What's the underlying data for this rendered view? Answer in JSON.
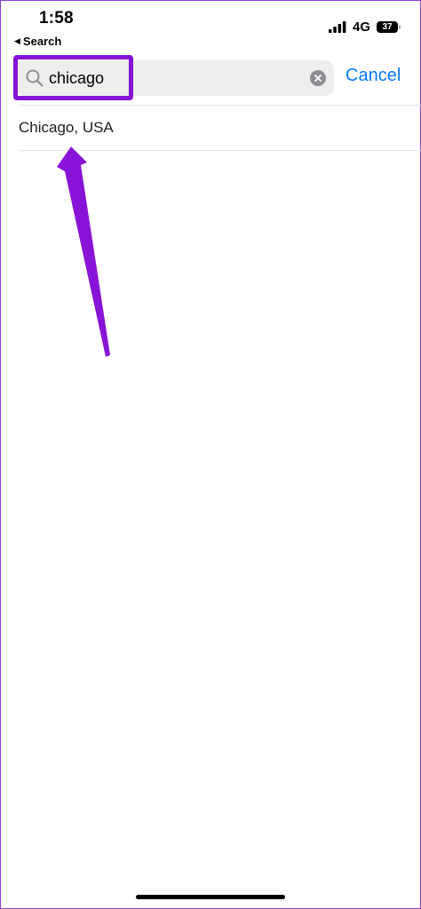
{
  "status_bar": {
    "time": "1:58",
    "back_label": "Search",
    "network": "4G",
    "battery_level": "37"
  },
  "search": {
    "value": "chicago",
    "cancel_label": "Cancel"
  },
  "results": [
    {
      "label": "Chicago, USA"
    }
  ],
  "colors": {
    "highlight": "#8714d6",
    "accent": "#0a7aff",
    "field_bg": "#eeeeef"
  },
  "icons": {
    "search": "search-icon",
    "clear": "clear-icon",
    "back": "back-triangle-icon",
    "signal": "signal-bars-icon",
    "battery": "battery-icon",
    "annotation": "arrow-annotation"
  }
}
